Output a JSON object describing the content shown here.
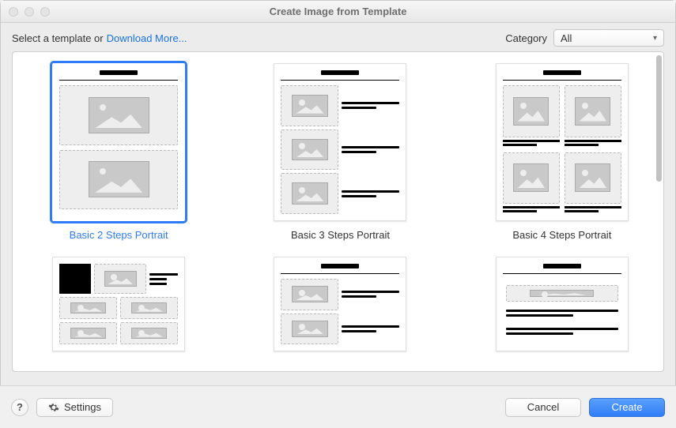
{
  "window": {
    "title": "Create Image from Template"
  },
  "top": {
    "lead": "Select a template or",
    "download": "Download More...",
    "category_label": "Category",
    "category_value": "All"
  },
  "templates": {
    "row1": [
      {
        "caption": "Basic 2 Steps Portrait",
        "selected": true
      },
      {
        "caption": "Basic 3 Steps Portrait",
        "selected": false
      },
      {
        "caption": "Basic 4 Steps Portrait",
        "selected": false
      }
    ]
  },
  "footer": {
    "help": "?",
    "settings": "Settings",
    "cancel": "Cancel",
    "create": "Create"
  }
}
